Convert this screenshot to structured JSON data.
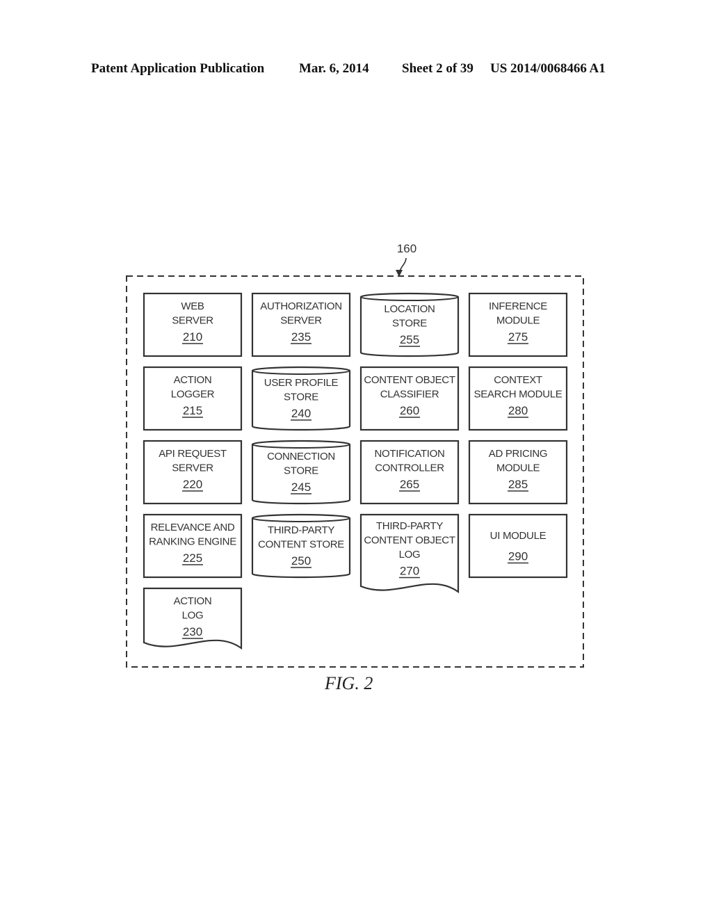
{
  "header": {
    "publication": "Patent Application Publication",
    "date": "Mar. 6, 2014",
    "sheet": "Sheet 2 of 39",
    "number": "US 2014/0068466 A1"
  },
  "figure": {
    "caption": "FIG. 2",
    "system_ref": "160",
    "components": [
      {
        "id": "c210",
        "lines": [
          "WEB",
          "SERVER"
        ],
        "ref": "210",
        "shape": "rect",
        "col": 0,
        "row": 0
      },
      {
        "id": "c215",
        "lines": [
          "ACTION",
          "LOGGER"
        ],
        "ref": "215",
        "shape": "rect",
        "col": 0,
        "row": 1
      },
      {
        "id": "c220",
        "lines": [
          "API REQUEST",
          "SERVER"
        ],
        "ref": "220",
        "shape": "rect",
        "col": 0,
        "row": 2
      },
      {
        "id": "c225",
        "lines": [
          "RELEVANCE AND",
          "RANKING ENGINE"
        ],
        "ref": "225",
        "shape": "rect",
        "col": 0,
        "row": 3
      },
      {
        "id": "c230",
        "lines": [
          "ACTION",
          "LOG"
        ],
        "ref": "230",
        "shape": "document",
        "col": 0,
        "row": 4
      },
      {
        "id": "c235",
        "lines": [
          "AUTHORIZATION",
          "SERVER"
        ],
        "ref": "235",
        "shape": "rect",
        "col": 1,
        "row": 0
      },
      {
        "id": "c240",
        "lines": [
          "USER PROFILE",
          "STORE"
        ],
        "ref": "240",
        "shape": "cylinder",
        "col": 1,
        "row": 1
      },
      {
        "id": "c245",
        "lines": [
          "CONNECTION",
          "STORE"
        ],
        "ref": "245",
        "shape": "cylinder",
        "col": 1,
        "row": 2
      },
      {
        "id": "c250",
        "lines": [
          "THIRD-PARTY",
          "CONTENT STORE"
        ],
        "ref": "250",
        "shape": "cylinder",
        "col": 1,
        "row": 3
      },
      {
        "id": "c255",
        "lines": [
          "LOCATION",
          "STORE"
        ],
        "ref": "255",
        "shape": "cylinder",
        "col": 2,
        "row": 0
      },
      {
        "id": "c260",
        "lines": [
          "CONTENT OBJECT",
          "CLASSIFIER"
        ],
        "ref": "260",
        "shape": "rect",
        "col": 2,
        "row": 1
      },
      {
        "id": "c265",
        "lines": [
          "NOTIFICATION",
          "CONTROLLER"
        ],
        "ref": "265",
        "shape": "rect",
        "col": 2,
        "row": 2
      },
      {
        "id": "c270",
        "lines": [
          "THIRD-PARTY",
          "CONTENT OBJECT",
          "LOG"
        ],
        "ref": "270",
        "shape": "document",
        "col": 2,
        "row": 3
      },
      {
        "id": "c275",
        "lines": [
          "INFERENCE",
          "MODULE"
        ],
        "ref": "275",
        "shape": "rect",
        "col": 3,
        "row": 0
      },
      {
        "id": "c280",
        "lines": [
          "CONTEXT",
          "SEARCH MODULE"
        ],
        "ref": "280",
        "shape": "rect",
        "col": 3,
        "row": 1
      },
      {
        "id": "c285",
        "lines": [
          "AD PRICING",
          "MODULE"
        ],
        "ref": "285",
        "shape": "rect",
        "col": 3,
        "row": 2
      },
      {
        "id": "c290",
        "lines": [
          "UI MODULE"
        ],
        "ref": "290",
        "shape": "rect",
        "col": 3,
        "row": 3
      }
    ]
  }
}
